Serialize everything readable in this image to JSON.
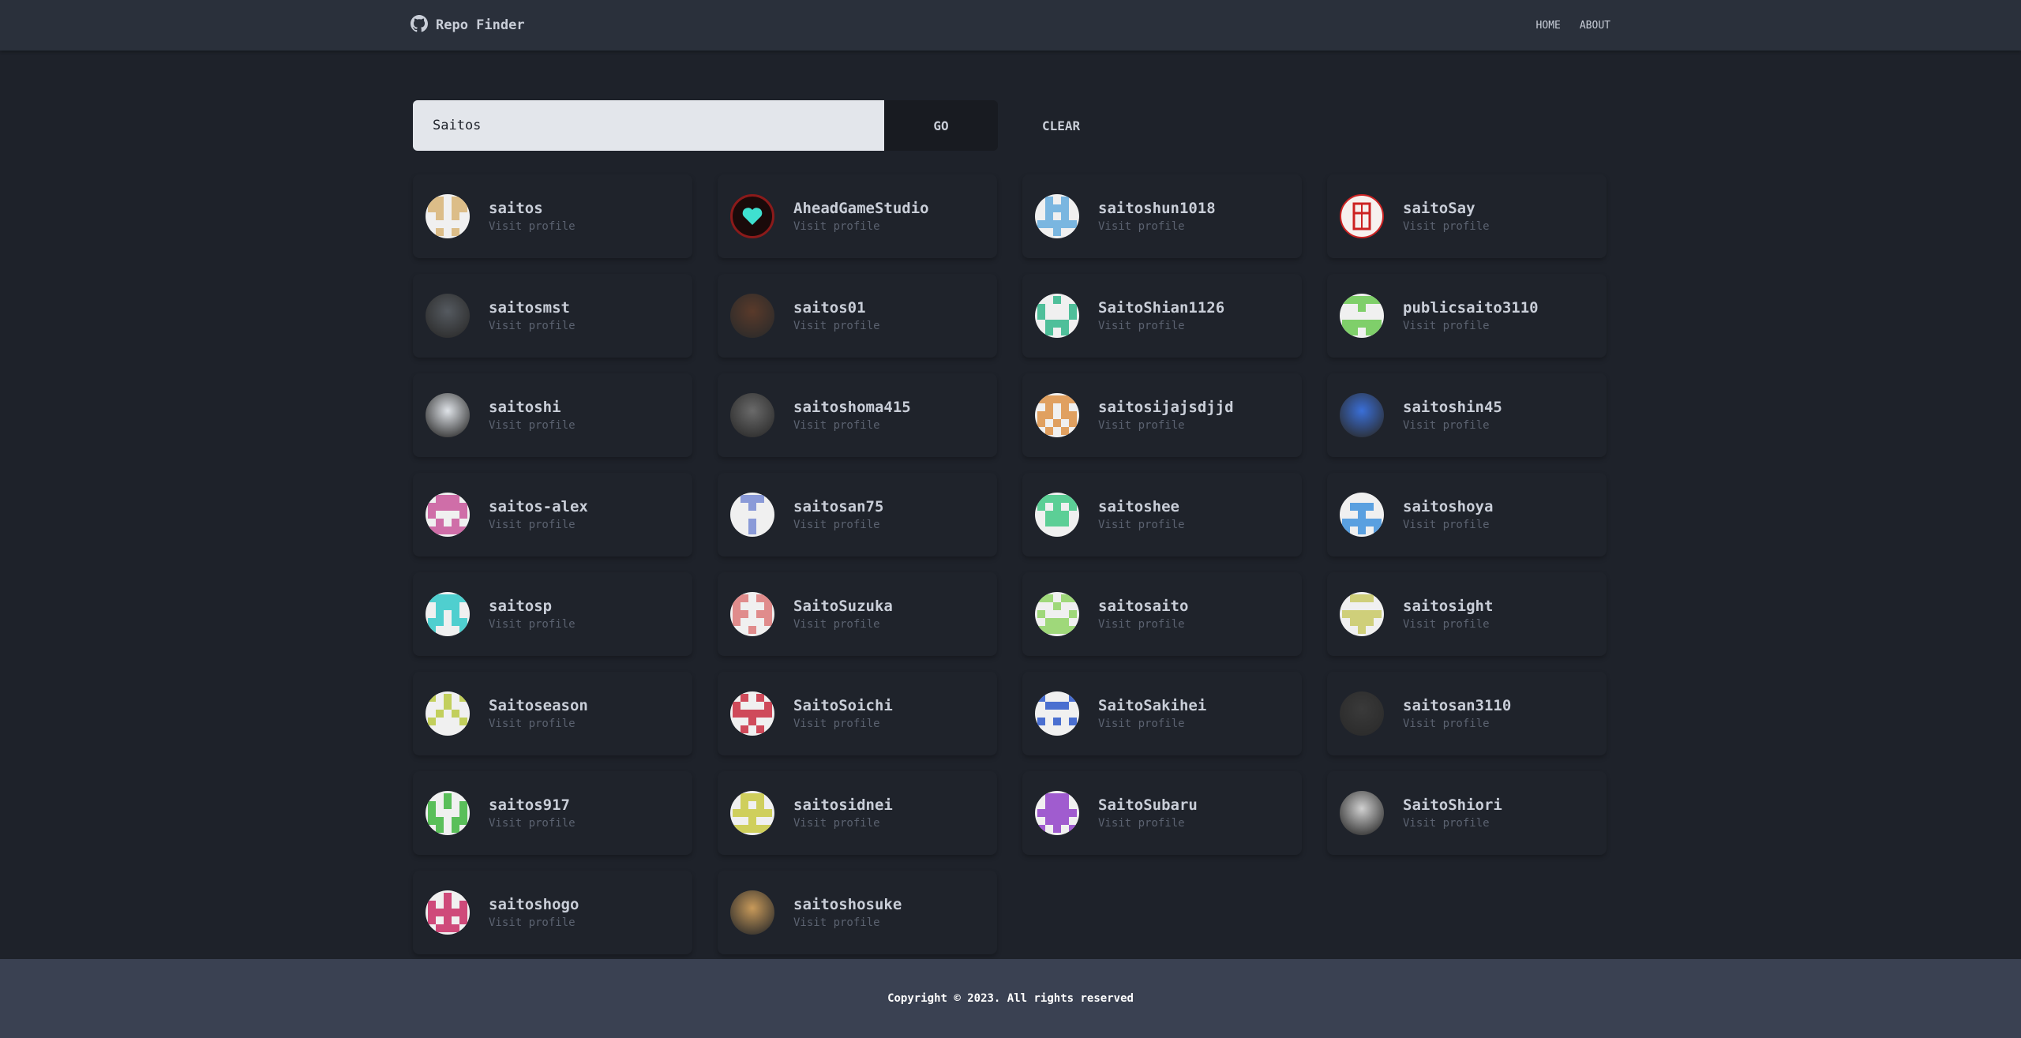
{
  "navbar": {
    "brand": "Repo Finder",
    "links": [
      "HOME",
      "ABOUT"
    ]
  },
  "search": {
    "value": "Saitos",
    "go_label": "GO",
    "clear_label": "CLEAR"
  },
  "results": [
    {
      "username": "saitos",
      "link_label": "Visit profile",
      "avatar_color": "#dcbd88",
      "avatar_style": "identicon"
    },
    {
      "username": "AheadGameStudio",
      "link_label": "Visit profile",
      "avatar_color": "#8b1a1a",
      "avatar_style": "logo-heart"
    },
    {
      "username": "saitoshun1018",
      "link_label": "Visit profile",
      "avatar_color": "#7ab6e0",
      "avatar_style": "identicon"
    },
    {
      "username": "saitoSay",
      "link_label": "Visit profile",
      "avatar_color": "#cc2222",
      "avatar_style": "logo-seal"
    },
    {
      "username": "saitosmst",
      "link_label": "Visit profile",
      "avatar_color": "#555a60",
      "avatar_style": "photo"
    },
    {
      "username": "saitos01",
      "link_label": "Visit profile",
      "avatar_color": "#5a3a2a",
      "avatar_style": "photo"
    },
    {
      "username": "SaitoShian1126",
      "link_label": "Visit profile",
      "avatar_color": "#4fbf9a",
      "avatar_style": "identicon"
    },
    {
      "username": "publicsaito3110",
      "link_label": "Visit profile",
      "avatar_color": "#7fcf6a",
      "avatar_style": "identicon"
    },
    {
      "username": "saitoshi",
      "link_label": "Visit profile",
      "avatar_color": "#dfe3e8",
      "avatar_style": "photo"
    },
    {
      "username": "saitoshoma415",
      "link_label": "Visit profile",
      "avatar_color": "#6a6a6a",
      "avatar_style": "photo"
    },
    {
      "username": "saitosijajsdjjd",
      "link_label": "Visit profile",
      "avatar_color": "#e0a060",
      "avatar_style": "identicon"
    },
    {
      "username": "saitoshin45",
      "link_label": "Visit profile",
      "avatar_color": "#3a6fd8",
      "avatar_style": "photo"
    },
    {
      "username": "saitos-alex",
      "link_label": "Visit profile",
      "avatar_color": "#cf6ea8",
      "avatar_style": "identicon"
    },
    {
      "username": "saitosan75",
      "link_label": "Visit profile",
      "avatar_color": "#8a9ad8",
      "avatar_style": "identicon"
    },
    {
      "username": "saitoshee",
      "link_label": "Visit profile",
      "avatar_color": "#5ccf96",
      "avatar_style": "identicon"
    },
    {
      "username": "saitoshoya",
      "link_label": "Visit profile",
      "avatar_color": "#5aa0e0",
      "avatar_style": "identicon"
    },
    {
      "username": "saitosp",
      "link_label": "Visit profile",
      "avatar_color": "#4fcfcf",
      "avatar_style": "identicon"
    },
    {
      "username": "SaitoSuzuka",
      "link_label": "Visit profile",
      "avatar_color": "#e08c8c",
      "avatar_style": "identicon"
    },
    {
      "username": "saitosaito",
      "link_label": "Visit profile",
      "avatar_color": "#9fd87a",
      "avatar_style": "identicon"
    },
    {
      "username": "saitosight",
      "link_label": "Visit profile",
      "avatar_color": "#cfcf7a",
      "avatar_style": "identicon"
    },
    {
      "username": "Saitoseason",
      "link_label": "Visit profile",
      "avatar_color": "#c2cf5c",
      "avatar_style": "identicon"
    },
    {
      "username": "SaitoSoichi",
      "link_label": "Visit profile",
      "avatar_color": "#cf4a5a",
      "avatar_style": "identicon"
    },
    {
      "username": "SaitoSakihei",
      "link_label": "Visit profile",
      "avatar_color": "#4a6fd0",
      "avatar_style": "identicon"
    },
    {
      "username": "saitosan3110",
      "link_label": "Visit profile",
      "avatar_color": "#3a3a3a",
      "avatar_style": "photo"
    },
    {
      "username": "saitos917",
      "link_label": "Visit profile",
      "avatar_color": "#5abf5a",
      "avatar_style": "identicon"
    },
    {
      "username": "saitosidnei",
      "link_label": "Visit profile",
      "avatar_color": "#cfcf5c",
      "avatar_style": "identicon"
    },
    {
      "username": "SaitoSubaru",
      "link_label": "Visit profile",
      "avatar_color": "#a05ccf",
      "avatar_style": "identicon"
    },
    {
      "username": "SaitoShiori",
      "link_label": "Visit profile",
      "avatar_color": "#d0d0d0",
      "avatar_style": "photo"
    },
    {
      "username": "saitoshogo",
      "link_label": "Visit profile",
      "avatar_color": "#cf4a7a",
      "avatar_style": "identicon"
    },
    {
      "username": "saitoshosuke",
      "link_label": "Visit profile",
      "avatar_color": "#c89a5a",
      "avatar_style": "photo"
    }
  ],
  "footer": {
    "copyright": "Copyright © 2023. All rights reserved"
  },
  "icons": {
    "brand_icon": "github-icon"
  }
}
